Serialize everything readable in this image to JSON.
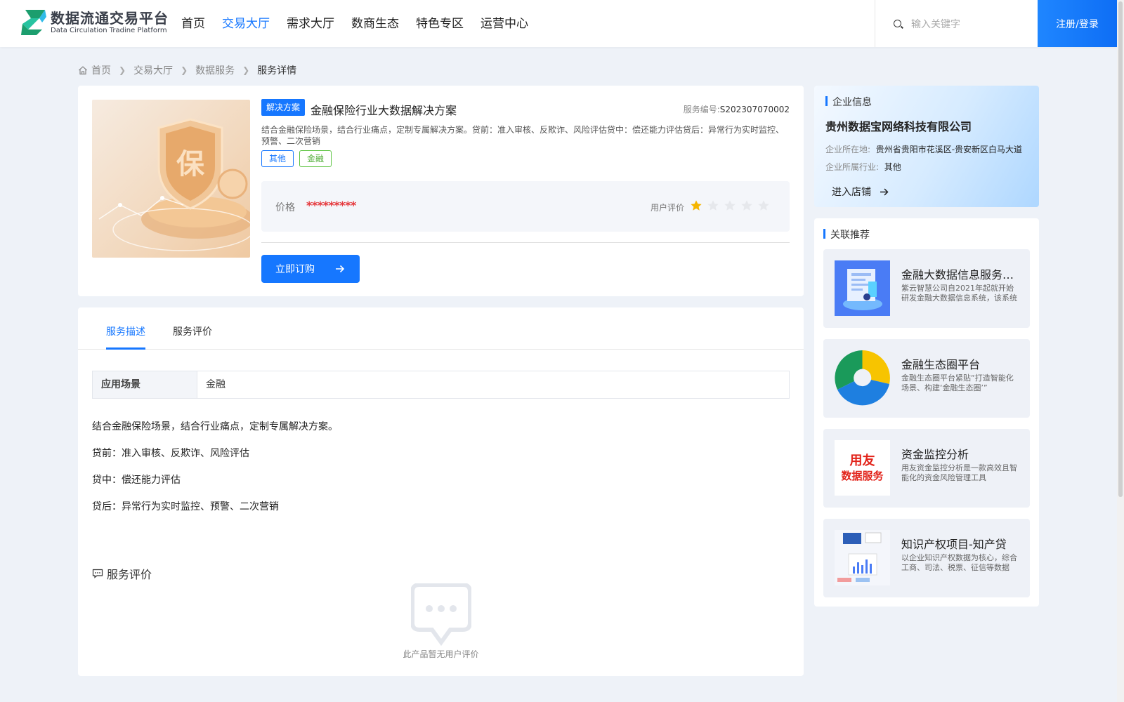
{
  "header": {
    "logo_cn": "数据流通交易平台",
    "logo_en": "Data Circulation Tradine Platform",
    "nav": [
      {
        "label": "首页",
        "active": false
      },
      {
        "label": "交易大厅",
        "active": true
      },
      {
        "label": "需求大厅",
        "active": false
      },
      {
        "label": "数商生态",
        "active": false
      },
      {
        "label": "特色专区",
        "active": false
      },
      {
        "label": "运营中心",
        "active": false
      }
    ],
    "search_placeholder": "输入关键字",
    "login_label": "注册/登录",
    "accent_color": "#1677ff"
  },
  "breadcrumb": {
    "items": [
      "首页",
      "交易大厅",
      "数据服务",
      "服务详情"
    ],
    "icon": "home-icon"
  },
  "product": {
    "type_badge": "解决方案",
    "title": "金融保险行业大数据解决方案",
    "service_no_label": "服务编号:",
    "service_no": "S202307070002",
    "description": "结合金融保险场景，结合行业痛点，定制专属解决方案。贷前：准入审核、反欺诈、风险评估贷中：偿还能力评估贷后：异常行为实时监控、预警、二次营销",
    "tags": [
      "其他",
      "金融"
    ],
    "price_label": "价格",
    "price_value": "*********",
    "rating_label": "用户评价",
    "rating": 1,
    "rating_max": 5,
    "buy_label": "立即订购"
  },
  "tabs": {
    "items": [
      "服务描述",
      "服务评价"
    ],
    "active": 0
  },
  "scene": {
    "label": "应用场景",
    "value": "金融"
  },
  "details": [
    "结合金融保险场景，结合行业痛点，定制专属解决方案。",
    "贷前：准入审核、反欺诈、风险评估",
    "贷中：偿还能力评估",
    "贷后：异常行为实时监控、预警、二次营销"
  ],
  "reviews": {
    "title": "服务评价",
    "empty_text": "此产品暂无用户评价"
  },
  "company": {
    "section_title": "企业信息",
    "name": "贵州数据宝网络科技有限公司",
    "location_label": "企业所在地:",
    "location": "贵州省贵阳市花溪区-贵安新区白马大道",
    "industry_label": "企业所属行业:",
    "industry": "其他",
    "shop_label": "进入店铺"
  },
  "recommend": {
    "section_title": "关联推荐",
    "items": [
      {
        "title": "金融大数据信息服务平台",
        "desc": "紫云智慧公司自2021年起就开始研发金融大数据信息系统，该系统",
        "thumb": "building-illustration"
      },
      {
        "title": "金融生态圈平台",
        "desc": "金融生态圈平台紧贴“打造智能化场景、构建‘金融生态圈’”",
        "thumb": "ring-chart"
      },
      {
        "title": "资金监控分析",
        "desc": "用友资金监控分析是一款高效且智能化的资金风险管理工具",
        "thumb": "yonyou-logo",
        "thumb_text_1": "用友",
        "thumb_text_2": "数据服务"
      },
      {
        "title": "知识产权项目-知产贷",
        "desc": "以企业知识产权数据为核心，综合工商、司法、税票、征信等数据",
        "thumb": "report-screenshot"
      }
    ]
  }
}
